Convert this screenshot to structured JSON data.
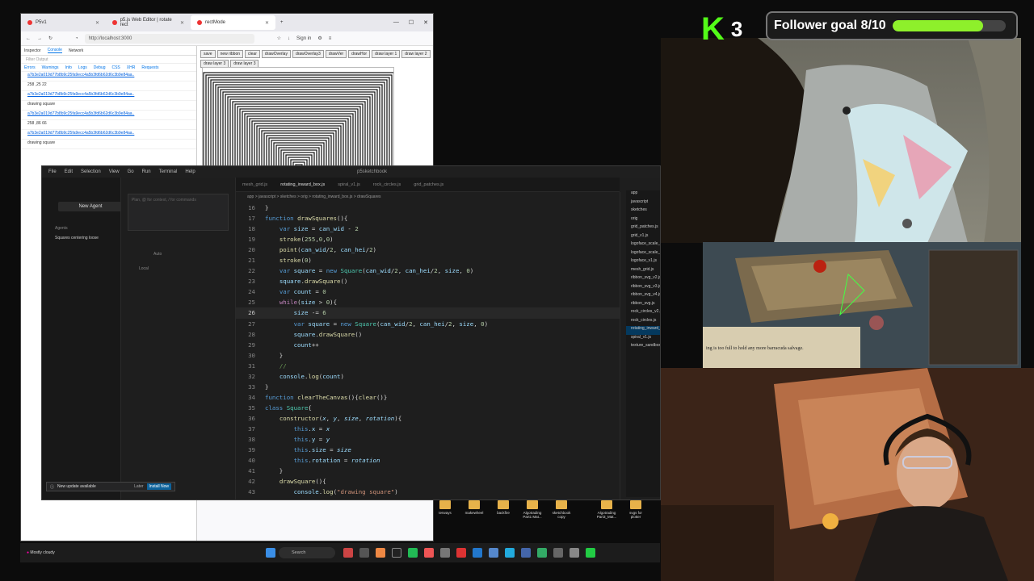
{
  "browser": {
    "tabs": [
      {
        "label": "P5v1",
        "active": false
      },
      {
        "label": "p5.js Web Editor | rotate rect",
        "active": false
      },
      {
        "label": "rectMode",
        "active": true
      }
    ],
    "url": "http://localhost:3000",
    "sign_in": "Sign in",
    "devtools_tabs": [
      "Inspector",
      "Console",
      "Network"
    ],
    "filter_placeholder": "Filter Output",
    "levels": [
      "Errors",
      "Warnings",
      "Info",
      "Logs",
      "Debug",
      "CSS",
      "XHR",
      "Requests"
    ],
    "log_lines": [
      {
        "text": "a7b3e2a019d77b8b9c25fa9ecc4a5b3fd6b62d6c3b9e84aa..",
        "link": true
      },
      {
        "text": "258 ,25 22",
        "link": false
      },
      {
        "text": "a7b3e2a019d77b8b9c25fa9ecc4a5b3fd6b62d6c3b9e84aa..",
        "link": true
      },
      {
        "text": "drawing square",
        "link": false
      },
      {
        "text": "a7b3e2a019d77b8b9c25fa9ecc4a5b3fd6b62d6c3b9e84aa..",
        "link": true
      },
      {
        "text": "258 ,86 66",
        "link": false
      },
      {
        "text": "a7b3e2a019d77b8b9c25fa9ecc4a5b3fd6b62d6c3b9e84aa..",
        "link": true
      },
      {
        "text": "drawing square",
        "link": false
      }
    ],
    "p5_buttons": [
      "save",
      "new ribbon",
      "clear",
      "drawOverlay",
      "drawOverlay3",
      "drawVer",
      "drawHor",
      "draw layer 1",
      "draw layer 2",
      "draw layer 3",
      "draw layer 3"
    ]
  },
  "vscode": {
    "menu": [
      "File",
      "Edit",
      "Selection",
      "View",
      "Go",
      "Run",
      "Terminal",
      "Help"
    ],
    "title": "p5sketchbook",
    "new_agent": "New Agent",
    "chat_placeholder": "Plan, @ for context, / for commands",
    "agents_heading": "Agents",
    "agent_item": "Squares centering loose",
    "mode": "Auto",
    "local": "Local",
    "tabs": [
      {
        "label": "mesh_grid.js",
        "active": false
      },
      {
        "label": "rotating_inward_box.js",
        "active": true
      },
      {
        "label": "spiral_v1.js",
        "active": false
      },
      {
        "label": "rock_circles.js",
        "active": false
      },
      {
        "label": "grid_patches.js",
        "active": false
      }
    ],
    "breadcrumbs": "app > javascript > sketches > orig > rotating_inward_box.js > drawSquares",
    "current_line": 26,
    "explorer": [
      "app",
      "javascript",
      "sketches",
      "orig",
      "grid_patches.js",
      "grid_v1.js",
      "logoface_scale_buffer_",
      "logoface_scale_b...",
      "logoface_v1.js",
      "mesh_grid.js",
      "ribbon_svg_v2.js",
      "ribbon_svg_v3.js",
      "ribbon_svg_v4.js",
      "ribbon_svg.js",
      "rock_circles_v2.js",
      "rock_circles.js",
      "rotating_inward_b...",
      "spiral_v1.js",
      "texture_sandbox.js"
    ],
    "notification": {
      "text": "New update available",
      "later": "Later",
      "install": "Install Now"
    }
  },
  "desktop_icons": [
    "terways",
    "makewheel",
    "backfire",
    "Algotrading Part1 Mat...",
    "sketchbook copy",
    "Algotrading Part3_Mat...",
    "svgs for plotter"
  ],
  "taskbar": {
    "weather": "Mostly cloudy",
    "search": "Search"
  },
  "stream": {
    "kick_count": "3",
    "goal_label": "Follower goal 8/10",
    "goal_current": 8,
    "goal_target": 10,
    "accent": "#53fc18"
  },
  "game": {
    "chat_text": "ing is too full to hold any more barracuda salvage."
  }
}
